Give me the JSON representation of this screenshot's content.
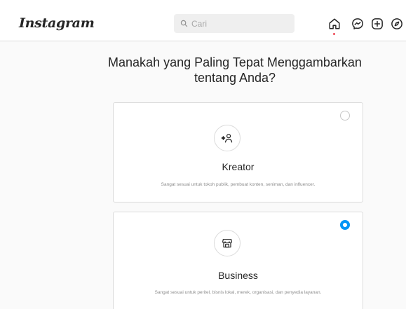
{
  "app": {
    "logo_text": "Instagram"
  },
  "search": {
    "placeholder": "Cari"
  },
  "nav": {
    "icons": [
      "home-icon",
      "messenger-icon",
      "new-post-icon",
      "explore-icon"
    ],
    "notification_color": "#ed4956"
  },
  "page": {
    "title": "Manakah yang Paling Tepat Menggambarkan tentang Anda?"
  },
  "options": [
    {
      "icon": "creator-icon",
      "title": "Kreator",
      "description": "Sangat sesuai untuk tokoh publik, pembuat konten, seniman, dan influencer.",
      "selected": false
    },
    {
      "icon": "shop-icon",
      "title": "Business",
      "description": "Sangat sesuai untuk peritel, bisnis lokal, merek, organisasi, dan penyedia layanan.",
      "selected": true
    }
  ],
  "colors": {
    "accent": "#0095f6",
    "border": "#dbdbdb",
    "muted_text": "#8e8e8e",
    "background": "#fafafa"
  }
}
